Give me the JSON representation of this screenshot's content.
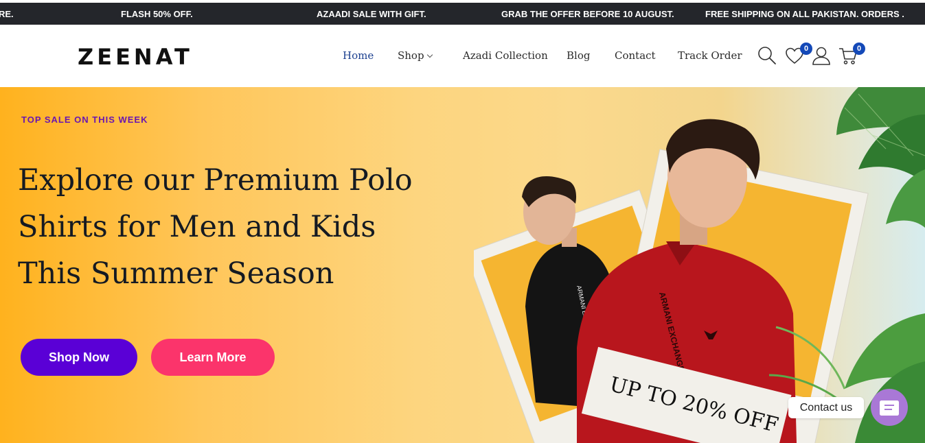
{
  "announcements": [
    "RE.",
    "FLASH 50% OFF.",
    "AZAADI SALE WITH GIFT.",
    "GRAB THE OFFER BEFORE 10 AUGUST.",
    "FREE SHIPPING ON ALL PAKISTAN. ORDERS ."
  ],
  "header": {
    "logo": "ZEENAT",
    "nav": [
      {
        "label": "Home",
        "active": true
      },
      {
        "label": "Shop",
        "dropdown": true
      },
      {
        "label": "Azadi Collection"
      },
      {
        "label": "Blog"
      },
      {
        "label": "Contact"
      },
      {
        "label": "Track Order"
      }
    ],
    "icons": [
      "search-icon",
      "heart-icon",
      "user-icon",
      "cart-icon"
    ],
    "wishlist_count": "0",
    "cart_count": "0"
  },
  "hero": {
    "eyebrow": "TOP SALE ON THIS WEEK",
    "headline": [
      "Explore our Premium Polo",
      "Shirts for Men and Kids",
      "This Summer Season"
    ],
    "shop_now": "Shop Now",
    "learn_more": "Learn More",
    "promo": "UP TO 20% OFF",
    "shirt_text_left": "ARMANI EXCHANGE",
    "shirt_text_right": "ARMANI EXCHANGE"
  },
  "contact_widget": {
    "label": "Contact us"
  },
  "colors": {
    "accent": "#1449b8",
    "primary_button": "#5a00d6",
    "secondary_button": "#fb346b",
    "eyebrow": "#6a16b0"
  }
}
